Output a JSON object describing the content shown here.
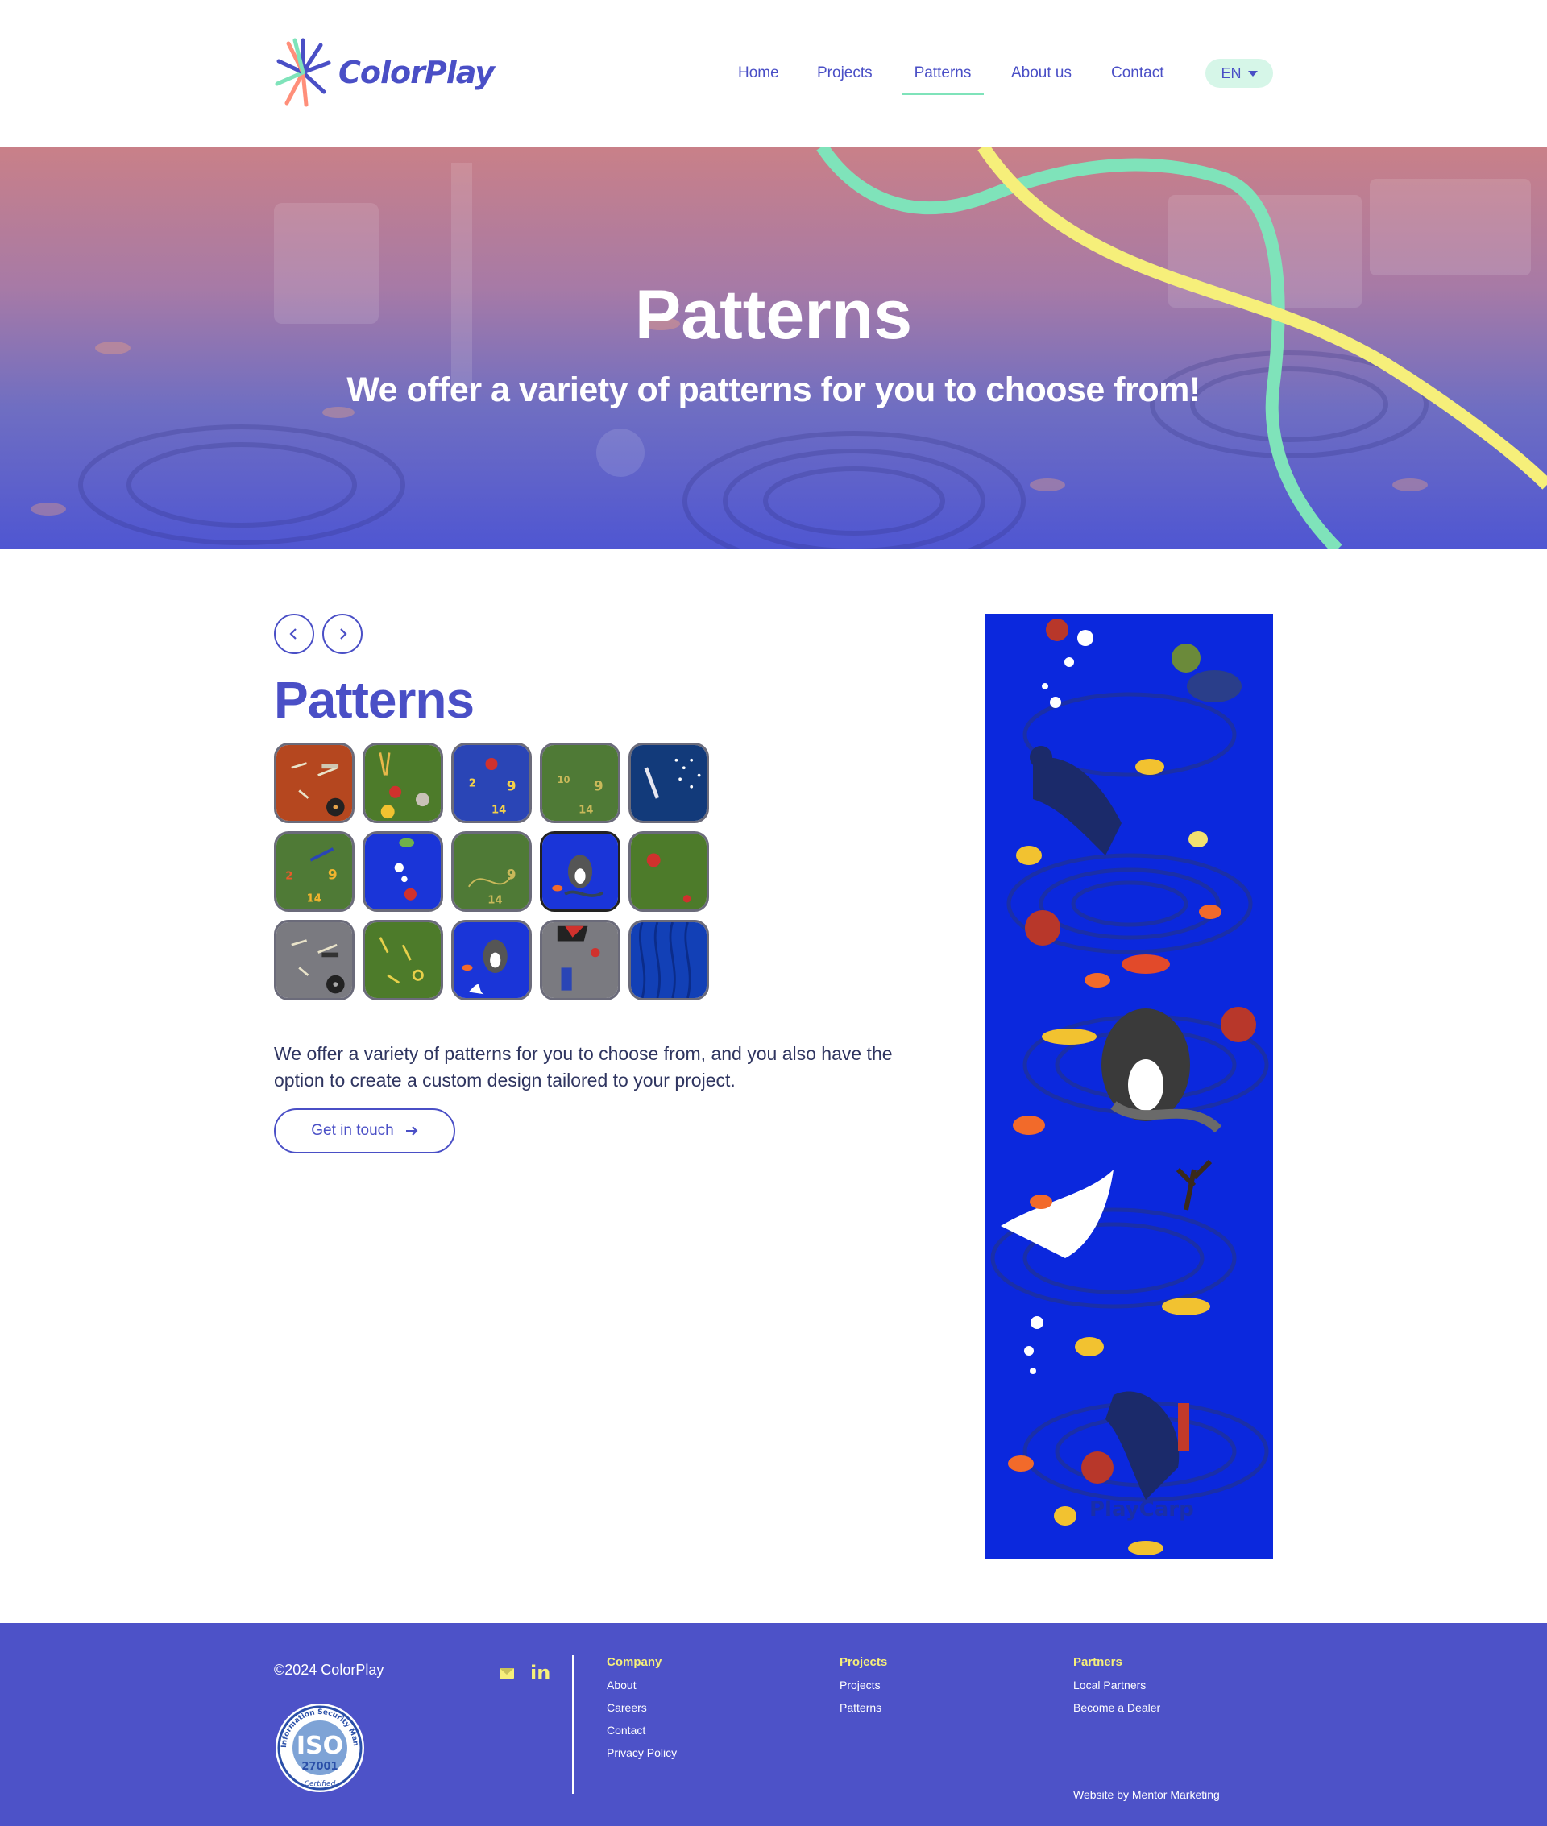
{
  "header": {
    "logo_text": "ColorPlay",
    "nav": [
      {
        "label": "Home",
        "active": false
      },
      {
        "label": "Projects",
        "active": false
      },
      {
        "label": "Patterns",
        "active": true
      },
      {
        "label": "About us",
        "active": false
      },
      {
        "label": "Contact",
        "active": false
      }
    ],
    "language": "EN"
  },
  "hero": {
    "title": "Patterns",
    "subtitle": "We offer a variety of patterns for you to choose from!"
  },
  "main": {
    "prev_icon": "chevron-left-icon",
    "next_icon": "chevron-right-icon",
    "title": "Patterns",
    "tiles": [
      {
        "name": "music-orange"
      },
      {
        "name": "garden-green"
      },
      {
        "name": "numbers-blue"
      },
      {
        "name": "numbers-green"
      },
      {
        "name": "diver-blue-dark"
      },
      {
        "name": "numbers-green-2"
      },
      {
        "name": "sea-blue"
      },
      {
        "name": "math-green"
      },
      {
        "name": "ocean-orca"
      },
      {
        "name": "garden-green-2"
      },
      {
        "name": "music-gray"
      },
      {
        "name": "alphabet-green"
      },
      {
        "name": "ocean-orca-2"
      },
      {
        "name": "diver-gray"
      },
      {
        "name": "waves-blue"
      }
    ],
    "description": "We offer a variety of patterns for you to choose from, and you also have the option to create a custom design tailored to your project.",
    "cta_label": "Get in touch",
    "cta_icon": "arrow-right-icon",
    "preview_watermark": "PlayCarp"
  },
  "footer": {
    "copyright": "©2024 ColorPlay",
    "iso_text": "ISO",
    "iso_number": "27001",
    "iso_ring_text": "Information Security Management",
    "iso_certified": "Certified",
    "social": [
      "mail-icon",
      "linkedin-icon"
    ],
    "linkedin_label": "in",
    "columns": [
      {
        "heading": "Company",
        "links": [
          "About",
          "Careers",
          "Contact",
          "Privacy Policy"
        ]
      },
      {
        "heading": "Projects",
        "links": [
          "Projects",
          "Patterns"
        ]
      },
      {
        "heading": "Partners",
        "links": [
          "Local Partners",
          "Become a Dealer"
        ]
      }
    ],
    "credit": "Website by  Mentor Marketing"
  },
  "colors": {
    "brand": "#4a4fc6",
    "accent_green": "#7fe3ba",
    "accent_yellow": "#f6ef7a",
    "footer_bg": "#4d52c8",
    "ocean_blue": "#0b28dd"
  }
}
